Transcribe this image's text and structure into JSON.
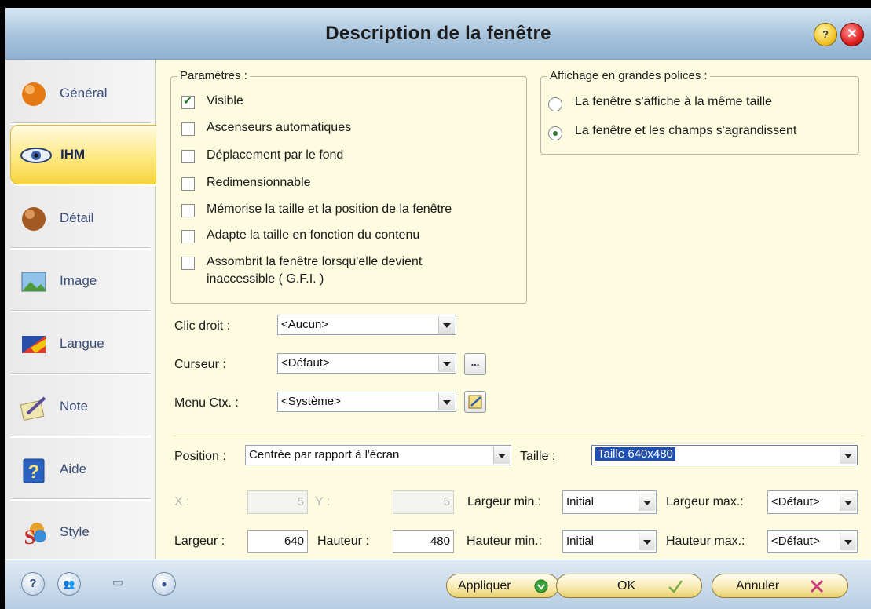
{
  "window": {
    "title": "Description de la fenêtre"
  },
  "titlebar": {
    "help_label": "?",
    "close_label": "✕"
  },
  "sidebar": {
    "items": [
      {
        "label": "Général",
        "icon": "orange-ball-icon"
      },
      {
        "label": "IHM",
        "icon": "eye-icon",
        "active": true
      },
      {
        "label": "Détail",
        "icon": "brown-ball-icon"
      },
      {
        "label": "Image",
        "icon": "image-icon"
      },
      {
        "label": "Langue",
        "icon": "flag-icon"
      },
      {
        "label": "Note",
        "icon": "note-pencil-icon"
      },
      {
        "label": "Aide",
        "icon": "question-book-icon"
      },
      {
        "label": "Style",
        "icon": "style-s-icon"
      }
    ]
  },
  "parametres": {
    "legend": "Paramètres :",
    "options": [
      {
        "label": "Visible",
        "checked": true
      },
      {
        "label": "Ascenseurs automatiques",
        "checked": false
      },
      {
        "label": "Déplacement par le fond",
        "checked": false
      },
      {
        "label": "Redimensionnable",
        "checked": false
      },
      {
        "label": "Mémorise la taille et la position de la fenêtre",
        "checked": false
      },
      {
        "label": "Adapte la taille en fonction du contenu",
        "checked": false
      },
      {
        "label": "Assombrit la fenêtre lorsqu'elle devient",
        "label2": "inaccessible ( G.F.I. )",
        "checked": false
      }
    ]
  },
  "affichage": {
    "legend": "Affichage en grandes polices :",
    "options": [
      {
        "label": "La fenêtre s'affiche à la même taille",
        "selected": false
      },
      {
        "label": "La fenêtre et les champs s'agrandissent",
        "selected": true
      }
    ]
  },
  "fields": {
    "clic_droit": {
      "label": "Clic droit :",
      "value": "<Aucun>"
    },
    "curseur": {
      "label": "Curseur :",
      "value": "<Défaut>",
      "button": "..."
    },
    "menu_ctx": {
      "label": "Menu Ctx. :",
      "value": "<Système>"
    }
  },
  "position": {
    "label": "Position :",
    "value": "Centrée par rapport à l'écran",
    "taille_label": "Taille :",
    "taille_value": "Taille 640x480",
    "x_label": "X :",
    "x_value": "5",
    "y_label": "Y :",
    "y_value": "5",
    "largeur_min_label": "Largeur min.:",
    "largeur_min_value": "Initial",
    "largeur_max_label": "Largeur max.:",
    "largeur_max_value": "<Défaut>",
    "largeur_label": "Largeur :",
    "largeur_value": "640",
    "hauteur_label": "Hauteur :",
    "hauteur_value": "480",
    "hauteur_min_label": "Hauteur min.:",
    "hauteur_min_value": "Initial",
    "hauteur_max_label": "Hauteur max.:",
    "hauteur_max_value": "<Défaut>"
  },
  "bottom": {
    "icons": [
      {
        "name": "help-circle-icon",
        "glyph": "?"
      },
      {
        "name": "users-icon",
        "glyph": "👥"
      },
      {
        "name": "chart-icon",
        "glyph": "▭"
      },
      {
        "name": "person-icon",
        "glyph": "●"
      }
    ],
    "apply_label": "Appliquer",
    "ok_label": "OK",
    "cancel_label": "Annuler"
  }
}
